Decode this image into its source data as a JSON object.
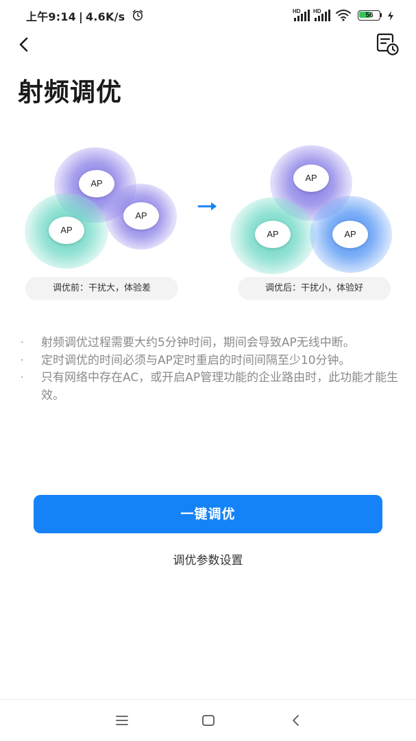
{
  "status_bar": {
    "time": "上午9:14",
    "speed": "4.6K/s",
    "hd_label": "HD",
    "battery_level": "56",
    "icons": [
      "alarm-icon",
      "signal-icon",
      "wifi-icon",
      "battery-icon",
      "charging-icon"
    ]
  },
  "header": {
    "back_icon": "chevron-left-icon",
    "history_icon": "document-clock-icon",
    "title": "射频调优"
  },
  "illustration": {
    "ap_label": "AP",
    "before_caption": "调优前：干扰大，体验差",
    "after_caption": "调优后：干扰小，体验好",
    "arrow_icon": "arrow-right-icon",
    "colors": {
      "purple": "#8b84e6",
      "teal": "#5fd3c0",
      "blue": "#3f8cf2",
      "arrow": "#1583f7"
    }
  },
  "notes": [
    {
      "bullet": "·",
      "text": "射频调优过程需要大约5分钟时间，期间会导致AP无线中断。"
    },
    {
      "bullet": "·",
      "text": "定时调优的时间必须与AP定时重启的时间间隔至少10分钟。"
    },
    {
      "bullet": "·",
      "text": "只有网络中存在AC，或开启AP管理功能的企业路由时，此功能才能生效。"
    }
  ],
  "actions": {
    "primary_label": "一键调优",
    "secondary_label": "调优参数设置",
    "accent": "#1583f7"
  },
  "navbar": {
    "icons": [
      "menu-icon",
      "home-square-icon",
      "back-triangle-icon"
    ]
  }
}
